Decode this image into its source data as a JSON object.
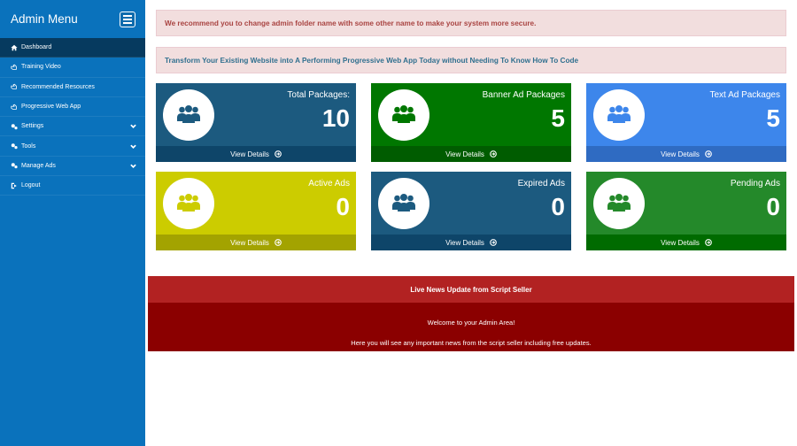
{
  "sidebar": {
    "title": "Admin Menu",
    "items": [
      {
        "label": "Dashboard",
        "icon": "home-icon"
      },
      {
        "label": "Training Video",
        "icon": "hand-point-icon"
      },
      {
        "label": "Recommended Resources",
        "icon": "hand-point-icon"
      },
      {
        "label": "Progressive Web App",
        "icon": "hand-point-icon"
      },
      {
        "label": "Settings",
        "icon": "gears-icon",
        "expandable": true
      },
      {
        "label": "Tools",
        "icon": "gears-icon",
        "expandable": true
      },
      {
        "label": "Manage Ads",
        "icon": "gears-icon",
        "expandable": true
      },
      {
        "label": "Logout",
        "icon": "sign-out-icon"
      }
    ]
  },
  "alerts": {
    "security": "We recommend you to change admin folder name with some other name to make your system more secure.",
    "pwa": "Transform Your Existing Website into A Performing Progressive Web App Today without Needing To Know How To Code"
  },
  "cards": [
    {
      "title": "Total Packages:",
      "value": "10",
      "footer": "View Details",
      "color": "#1c5a7f",
      "footer_color": "#0e4569",
      "icon_color": "#1c5a7f"
    },
    {
      "title": "Banner Ad Packages",
      "value": "5",
      "footer": "View Details",
      "color": "#007700",
      "footer_color": "#005c00",
      "icon_color": "#007700"
    },
    {
      "title": "Text Ad Packages",
      "value": "5",
      "footer": "View Details",
      "color": "#3d86eb",
      "footer_color": "#2f6bc2",
      "icon_color": "#3d86eb"
    },
    {
      "title": "Active Ads",
      "value": "0",
      "footer": "View Details",
      "color": "#cccc00",
      "footer_color": "#a3a300",
      "icon_color": "#cccc00"
    },
    {
      "title": "Expired Ads",
      "value": "0",
      "footer": "View Details",
      "color": "#1c5a7f",
      "footer_color": "#0e4569",
      "icon_color": "#1c5a7f"
    },
    {
      "title": "Pending Ads",
      "value": "0",
      "footer": "View Details",
      "color": "#24892a",
      "footer_color": "#006b00",
      "icon_color": "#24892a"
    }
  ],
  "news": {
    "header": "Live News Update from Script Seller",
    "line1": "Welcome to your Admin Area!",
    "line2": "Here you will see any important news from the script seller including free updates."
  },
  "colors": {
    "sidebar": "#0a72bc",
    "sidebar_active": "#063a5f",
    "news_header": "#b22222",
    "news_body": "#8b0000"
  }
}
